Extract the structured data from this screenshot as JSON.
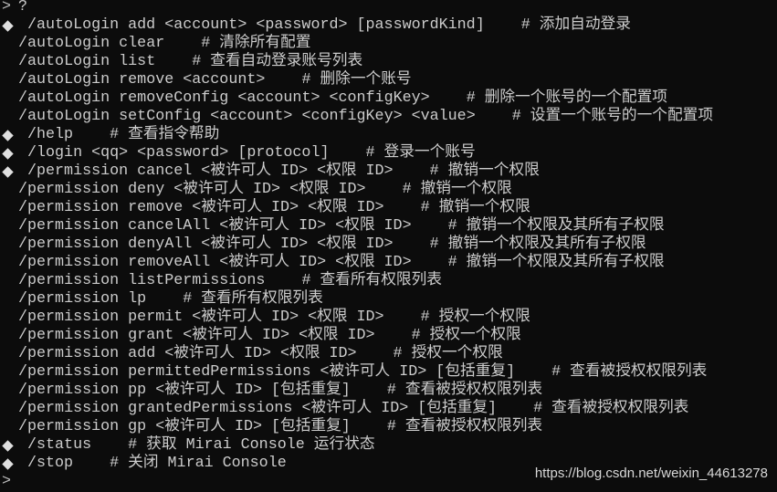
{
  "terminal": {
    "prompt_symbol": ">",
    "first_input": "?",
    "lines": [
      {
        "bullet": true,
        "text": "/autoLogin add <account> <password> [passwordKind]    # 添加自动登录"
      },
      {
        "bullet": false,
        "text": "/autoLogin clear    # 清除所有配置"
      },
      {
        "bullet": false,
        "text": "/autoLogin list    # 查看自动登录账号列表"
      },
      {
        "bullet": false,
        "text": "/autoLogin remove <account>    # 删除一个账号"
      },
      {
        "bullet": false,
        "text": "/autoLogin removeConfig <account> <configKey>    # 删除一个账号的一个配置项"
      },
      {
        "bullet": false,
        "text": "/autoLogin setConfig <account> <configKey> <value>    # 设置一个账号的一个配置项"
      },
      {
        "bullet": true,
        "text": "/help    # 查看指令帮助"
      },
      {
        "bullet": true,
        "text": "/login <qq> <password> [protocol]    # 登录一个账号"
      },
      {
        "bullet": true,
        "text": "/permission cancel <被许可人 ID> <权限 ID>    # 撤销一个权限"
      },
      {
        "bullet": false,
        "text": "/permission deny <被许可人 ID> <权限 ID>    # 撤销一个权限"
      },
      {
        "bullet": false,
        "text": "/permission remove <被许可人 ID> <权限 ID>    # 撤销一个权限"
      },
      {
        "bullet": false,
        "text": "/permission cancelAll <被许可人 ID> <权限 ID>    # 撤销一个权限及其所有子权限"
      },
      {
        "bullet": false,
        "text": "/permission denyAll <被许可人 ID> <权限 ID>    # 撤销一个权限及其所有子权限"
      },
      {
        "bullet": false,
        "text": "/permission removeAll <被许可人 ID> <权限 ID>    # 撤销一个权限及其所有子权限"
      },
      {
        "bullet": false,
        "text": "/permission listPermissions    # 查看所有权限列表"
      },
      {
        "bullet": false,
        "text": "/permission lp    # 查看所有权限列表"
      },
      {
        "bullet": false,
        "text": "/permission permit <被许可人 ID> <权限 ID>    # 授权一个权限"
      },
      {
        "bullet": false,
        "text": "/permission grant <被许可人 ID> <权限 ID>    # 授权一个权限"
      },
      {
        "bullet": false,
        "text": "/permission add <被许可人 ID> <权限 ID>    # 授权一个权限"
      },
      {
        "bullet": false,
        "text": "/permission permittedPermissions <被许可人 ID> [包括重复]    # 查看被授权权限列表"
      },
      {
        "bullet": false,
        "text": "/permission pp <被许可人 ID> [包括重复]    # 查看被授权权限列表"
      },
      {
        "bullet": false,
        "text": "/permission grantedPermissions <被许可人 ID> [包括重复]    # 查看被授权权限列表"
      },
      {
        "bullet": false,
        "text": "/permission gp <被许可人 ID> [包括重复]    # 查看被授权权限列表"
      },
      {
        "bullet": true,
        "text": "/status    # 获取 Mirai Console 运行状态"
      },
      {
        "bullet": true,
        "text": "/stop    # 关闭 Mirai Console"
      }
    ]
  },
  "watermark": "https://blog.csdn.net/weixin_44613278",
  "colors": {
    "background": "#0c0c0c",
    "text": "#cccccc"
  }
}
